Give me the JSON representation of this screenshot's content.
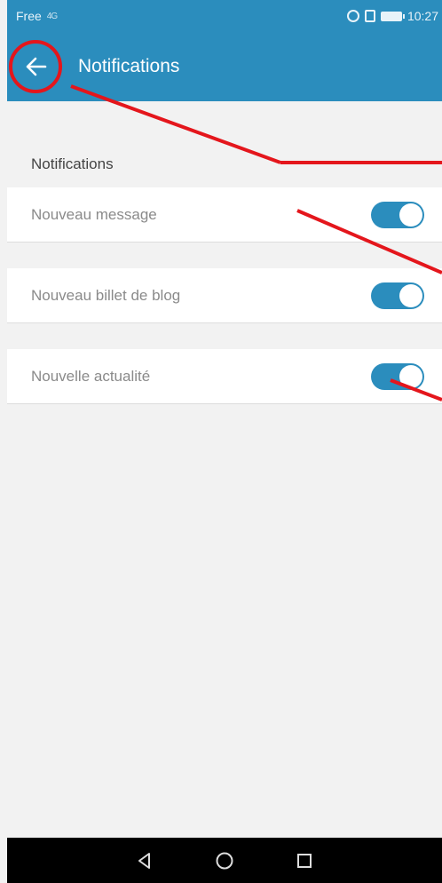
{
  "status_bar": {
    "carrier": "Free",
    "signal": "4G",
    "time": "10:27"
  },
  "app_bar": {
    "title": "Notifications",
    "back_icon": "arrow-left-icon"
  },
  "section": {
    "title": "Notifications"
  },
  "settings": [
    {
      "label": "Nouveau message",
      "enabled": true
    },
    {
      "label": "Nouveau billet de blog",
      "enabled": true
    },
    {
      "label": "Nouvelle actualité",
      "enabled": true
    }
  ],
  "nav_bar": {
    "icons": [
      "back-triangle-icon",
      "home-circle-icon",
      "recents-square-icon"
    ]
  },
  "colors": {
    "primary": "#2b8dbd",
    "annotation": "#e4161c",
    "background": "#f2f2f2"
  }
}
